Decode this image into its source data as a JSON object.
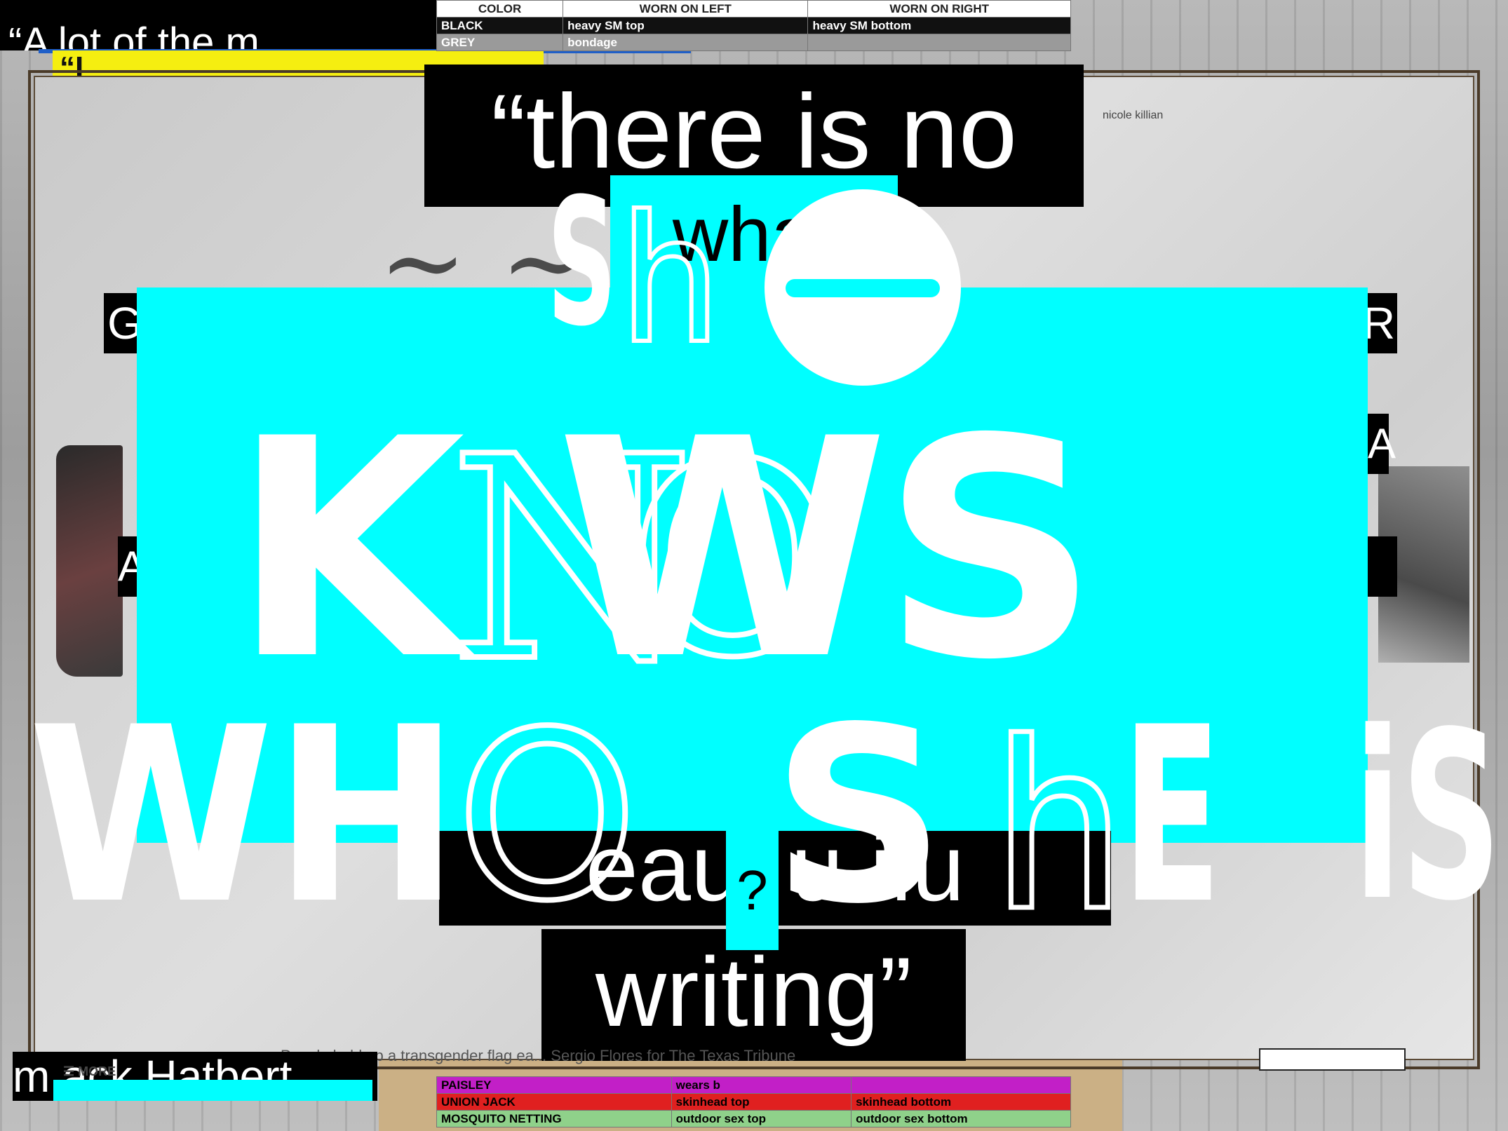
{
  "collage": {
    "quote_top_left": "“A lot of the m",
    "quote_yellow": "“I",
    "main_quote_line1": "“there is no",
    "main_quote_what": "what",
    "main_quote_bottom": "eaui u  iiu",
    "main_quote_end": "writing”",
    "question_mark": "?",
    "attribution": "nicole killian",
    "side_left_letter": "G",
    "side_right_letter": "R",
    "side_right_a": "A",
    "side_left_a": "A",
    "caption": "People held up a transgender flag ea... Sergio Flores for The Texas Tribune",
    "more_label": "☰  MORE",
    "bottom_left_text": "m  ack Hatbert"
  },
  "big_words": {
    "she_s": "S",
    "she_h": "h",
    "knows": "K    WS",
    "knows_n": "N",
    "knows_o": "O",
    "who": "WH",
    "who_o": "O",
    "she2_s": "S",
    "she2_h": "h",
    "she2_e": "E",
    "is": "iS"
  },
  "table_top": {
    "headers": [
      "COLOR",
      "WORN ON LEFT",
      "WORN ON RIGHT"
    ],
    "rows": [
      {
        "color": "BLACK",
        "left": "heavy SM top",
        "right": "heavy SM bottom",
        "bg": "#111111",
        "fg": "#ffffff"
      },
      {
        "color": "GREY",
        "left": "bondage",
        "right": "",
        "bg": "#9a9a9a",
        "fg": "#ffffff"
      }
    ]
  },
  "table_bottom": {
    "rows": [
      {
        "color": "PAISLEY",
        "left": "wears b",
        "right": "",
        "bg": "#c21fc7",
        "fg": "#111111"
      },
      {
        "color": "UNION JACK",
        "left": "skinhead top",
        "right": "skinhead bottom",
        "bg": "#e02020",
        "fg": "#111111"
      },
      {
        "color": "MOSQUITO NETTING",
        "left": "outdoor sex top",
        "right": "outdoor sex bottom",
        "bg": "#8fd18a",
        "fg": "#111111"
      }
    ]
  },
  "colors": {
    "accent_cyan": "#00ffff",
    "text_white": "#ffffff",
    "bg_black": "#000000"
  }
}
